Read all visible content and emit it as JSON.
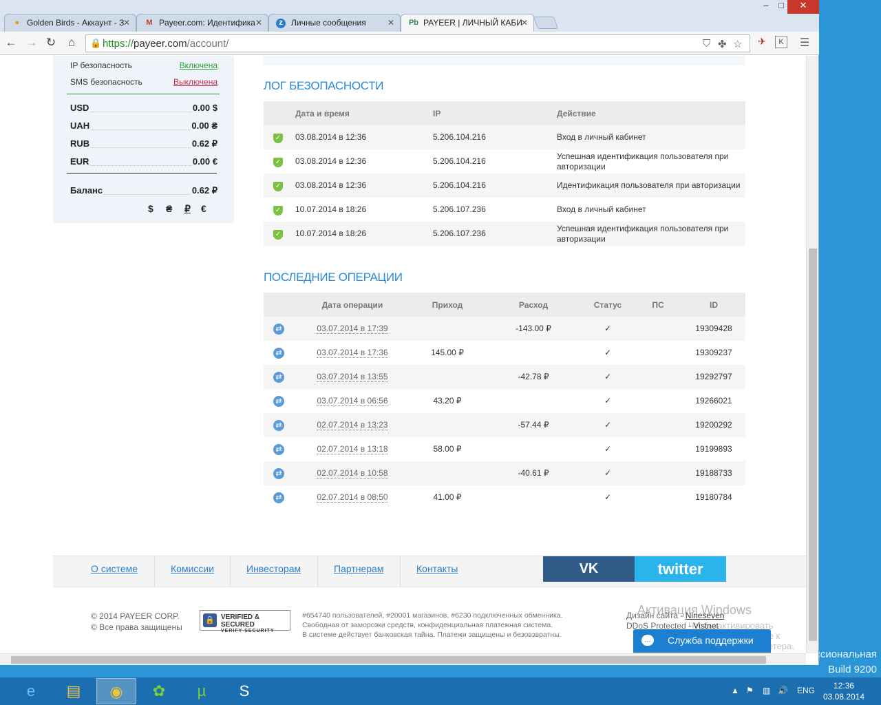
{
  "browser": {
    "tabs": [
      {
        "icon": "egg-icon",
        "label": "Golden Birds - Аккаунт - З",
        "active": false
      },
      {
        "icon": "gmail-icon",
        "label": "Payeer.com: Идентифика",
        "active": false
      },
      {
        "icon": "z-icon",
        "label": "Личные сообщения",
        "active": false
      },
      {
        "icon": "payeer-icon",
        "label": "PAYEER | ЛИЧНЫЙ КАБИ",
        "active": true
      }
    ],
    "tab_icon_text": {
      "payeer": "Pb",
      "z": "z",
      "gmail": "M"
    },
    "url_scheme": "https://",
    "url_host": "payeer.com",
    "url_path": "/account/",
    "window_controls": {
      "min": "–",
      "max": "□",
      "close": "✕"
    }
  },
  "sidebar": {
    "security": [
      {
        "label": "IP безопасность",
        "value": "Включена",
        "color": "#2e9d2e"
      },
      {
        "label": "SMS безопасность",
        "value": "Выключена",
        "color": "#d0284a"
      }
    ],
    "balances": [
      {
        "currency": "USD",
        "amount": "0.00 $"
      },
      {
        "currency": "UAH",
        "amount": "0.00 ₴"
      },
      {
        "currency": "RUB",
        "amount": "0.62 ₽"
      },
      {
        "currency": "EUR",
        "amount": "0.00 €"
      }
    ],
    "total": {
      "label": "Баланс",
      "amount": "0.62 ₽"
    },
    "currency_switch": [
      "$",
      "₴",
      "₽",
      "€"
    ]
  },
  "security_log": {
    "title": "ЛОГ БЕЗОПАСНОСТИ",
    "headers": [
      "Дата и время",
      "IP",
      "Действие"
    ],
    "rows": [
      {
        "datetime": "03.08.2014 в 12:36",
        "ip": "5.206.104.216",
        "action": "Вход в личный кабинет"
      },
      {
        "datetime": "03.08.2014 в 12:36",
        "ip": "5.206.104.216",
        "action": "Успешная идентификация пользователя при авторизации"
      },
      {
        "datetime": "03.08.2014 в 12:36",
        "ip": "5.206.104.216",
        "action": "Идентификация пользователя при авторизации"
      },
      {
        "datetime": "10.07.2014 в 18:26",
        "ip": "5.206.107.236",
        "action": "Вход в личный кабинет"
      },
      {
        "datetime": "10.07.2014 в 18:26",
        "ip": "5.206.107.236",
        "action": "Успешная идентификация пользователя при авторизации"
      }
    ]
  },
  "operations": {
    "title": "ПОСЛЕДНИЕ ОПЕРАЦИИ",
    "headers": [
      "Дата операции",
      "Приход",
      "Расход",
      "Статус",
      "ПС",
      "ID"
    ],
    "rows": [
      {
        "date": "03.07.2014 в 17:39",
        "income": "",
        "expense": "-143.00 ₽",
        "status": "✓",
        "ps": "",
        "id": "19309428"
      },
      {
        "date": "03.07.2014 в 17:36",
        "income": "145.00 ₽",
        "expense": "",
        "status": "✓",
        "ps": "",
        "id": "19309237"
      },
      {
        "date": "03.07.2014 в 13:55",
        "income": "",
        "expense": "-42.78 ₽",
        "status": "✓",
        "ps": "",
        "id": "19292797"
      },
      {
        "date": "03.07.2014 в 06:56",
        "income": "43.20 ₽",
        "expense": "",
        "status": "✓",
        "ps": "",
        "id": "19266021"
      },
      {
        "date": "02.07.2014 в 13:23",
        "income": "",
        "expense": "-57.44 ₽",
        "status": "✓",
        "ps": "",
        "id": "19200292"
      },
      {
        "date": "02.07.2014 в 13:18",
        "income": "58.00 ₽",
        "expense": "",
        "status": "✓",
        "ps": "",
        "id": "19199893"
      },
      {
        "date": "02.07.2014 в 10:58",
        "income": "",
        "expense": "-40.61 ₽",
        "status": "✓",
        "ps": "",
        "id": "19188733"
      },
      {
        "date": "02.07.2014 в 08:50",
        "income": "41.00 ₽",
        "expense": "",
        "status": "✓",
        "ps": "",
        "id": "19180784"
      }
    ]
  },
  "footer": {
    "nav": [
      "О системе",
      "Комиссии",
      "Инвесторам",
      "Партнерам",
      "Контакты"
    ],
    "vk_label": "VK",
    "twitter_label": "twitter",
    "copyright_1": "© 2014 PAYEER CORP.",
    "copyright_2": "© Все права защищены",
    "badge_line1": "VERIFIED & SECURED",
    "badge_line2": "VERIFY SECURITY",
    "stats_1": "#654740 пользователей, #20001 магазинов, #6230 подключенных обменника.",
    "stats_2": "Свободная от заморозки средств, конфиденциальная платежная система.",
    "stats_3": "В системе действует банковская тайна. Платежи защищены и безовзвратны.",
    "design_label": "Дизайн сайта - ",
    "design_link": "Nineseven",
    "ddos_label": "DDoS Protected - ",
    "ddos_link": "Vistnet",
    "support": "Служба поддержки"
  },
  "os": {
    "activation_title": "Активация Windows",
    "activation_text": "Чтобы активировать Windows, перейдите к",
    "activation_text2": "параметрам компьютера.",
    "edition": "ссиональная",
    "build": "Build 9200",
    "lang": "ENG",
    "time": "12:36",
    "date": "03.08.2014"
  }
}
